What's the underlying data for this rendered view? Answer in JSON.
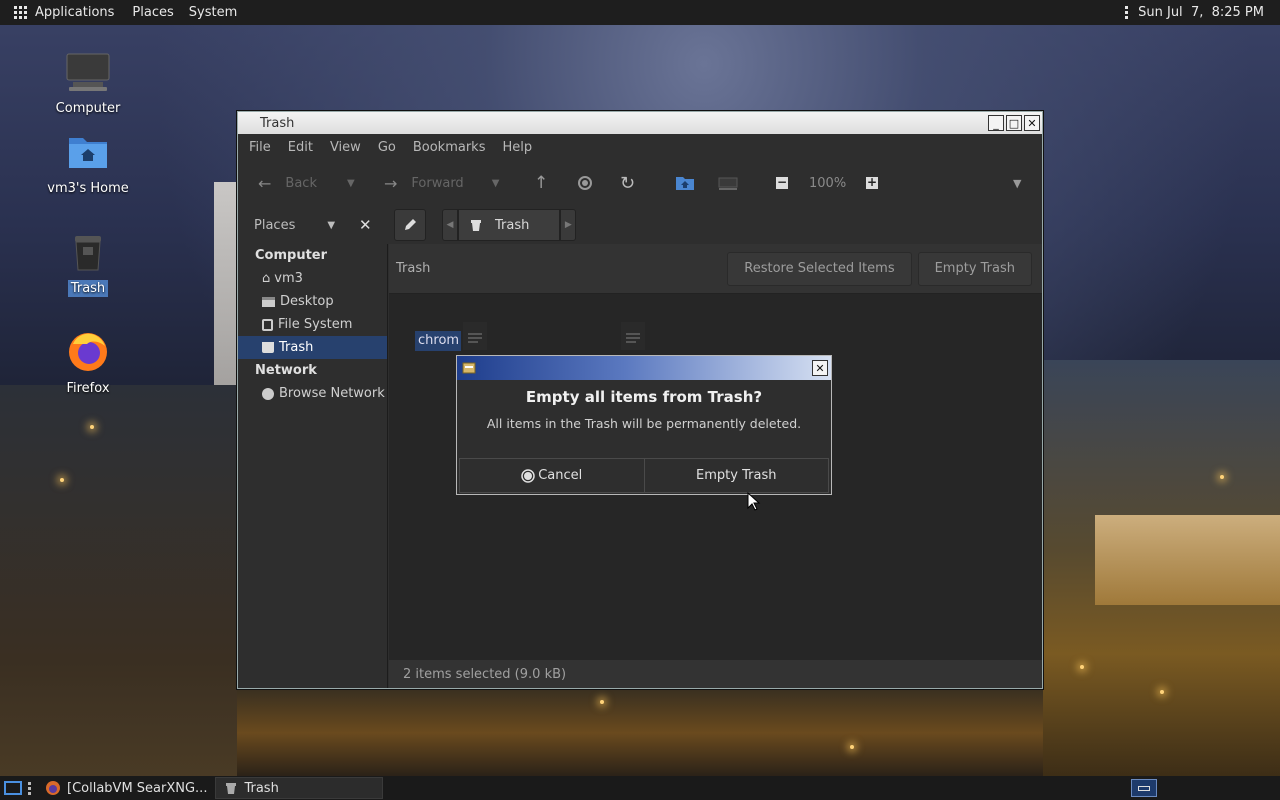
{
  "top_panel": {
    "menus": [
      "Applications",
      "Places",
      "System"
    ],
    "clock": "Sun Jul  7,  8:25 PM"
  },
  "desktop": {
    "icons": [
      {
        "label": "Computer",
        "icon": "computer-icon"
      },
      {
        "label": "vm3's Home",
        "icon": "home-folder-icon"
      },
      {
        "label": "Trash",
        "icon": "trash-icon",
        "selected": true
      },
      {
        "label": "Firefox",
        "icon": "firefox-icon"
      }
    ]
  },
  "window": {
    "title": "Trash",
    "menus": [
      "File",
      "Edit",
      "View",
      "Go",
      "Bookmarks",
      "Help"
    ],
    "toolbar": {
      "back": "Back",
      "forward": "Forward",
      "zoom": "100%"
    },
    "places_label": "Places",
    "sidebar": {
      "computer_header": "Computer",
      "computer_items": [
        "vm3",
        "Desktop",
        "File System",
        "Trash"
      ],
      "network_header": "Network",
      "network_items": [
        "Browse Network"
      ]
    },
    "path": "Trash",
    "infobar": {
      "label": "Trash",
      "restore": "Restore Selected Items",
      "empty": "Empty Trash"
    },
    "file_partial": "chrom",
    "status": "2 items selected (9.0 kB)"
  },
  "dialog": {
    "heading": "Empty all items from Trash?",
    "message": "All items in the Trash will be permanently deleted.",
    "cancel": "Cancel",
    "confirm": "Empty Trash"
  },
  "taskbar": {
    "items": [
      "[CollabVM SearXNG...",
      "Trash"
    ]
  },
  "colors": {
    "selection": "#27416e",
    "dialog_title_start": "#1e3d8c",
    "panel_bg": "#1e1e1e"
  }
}
